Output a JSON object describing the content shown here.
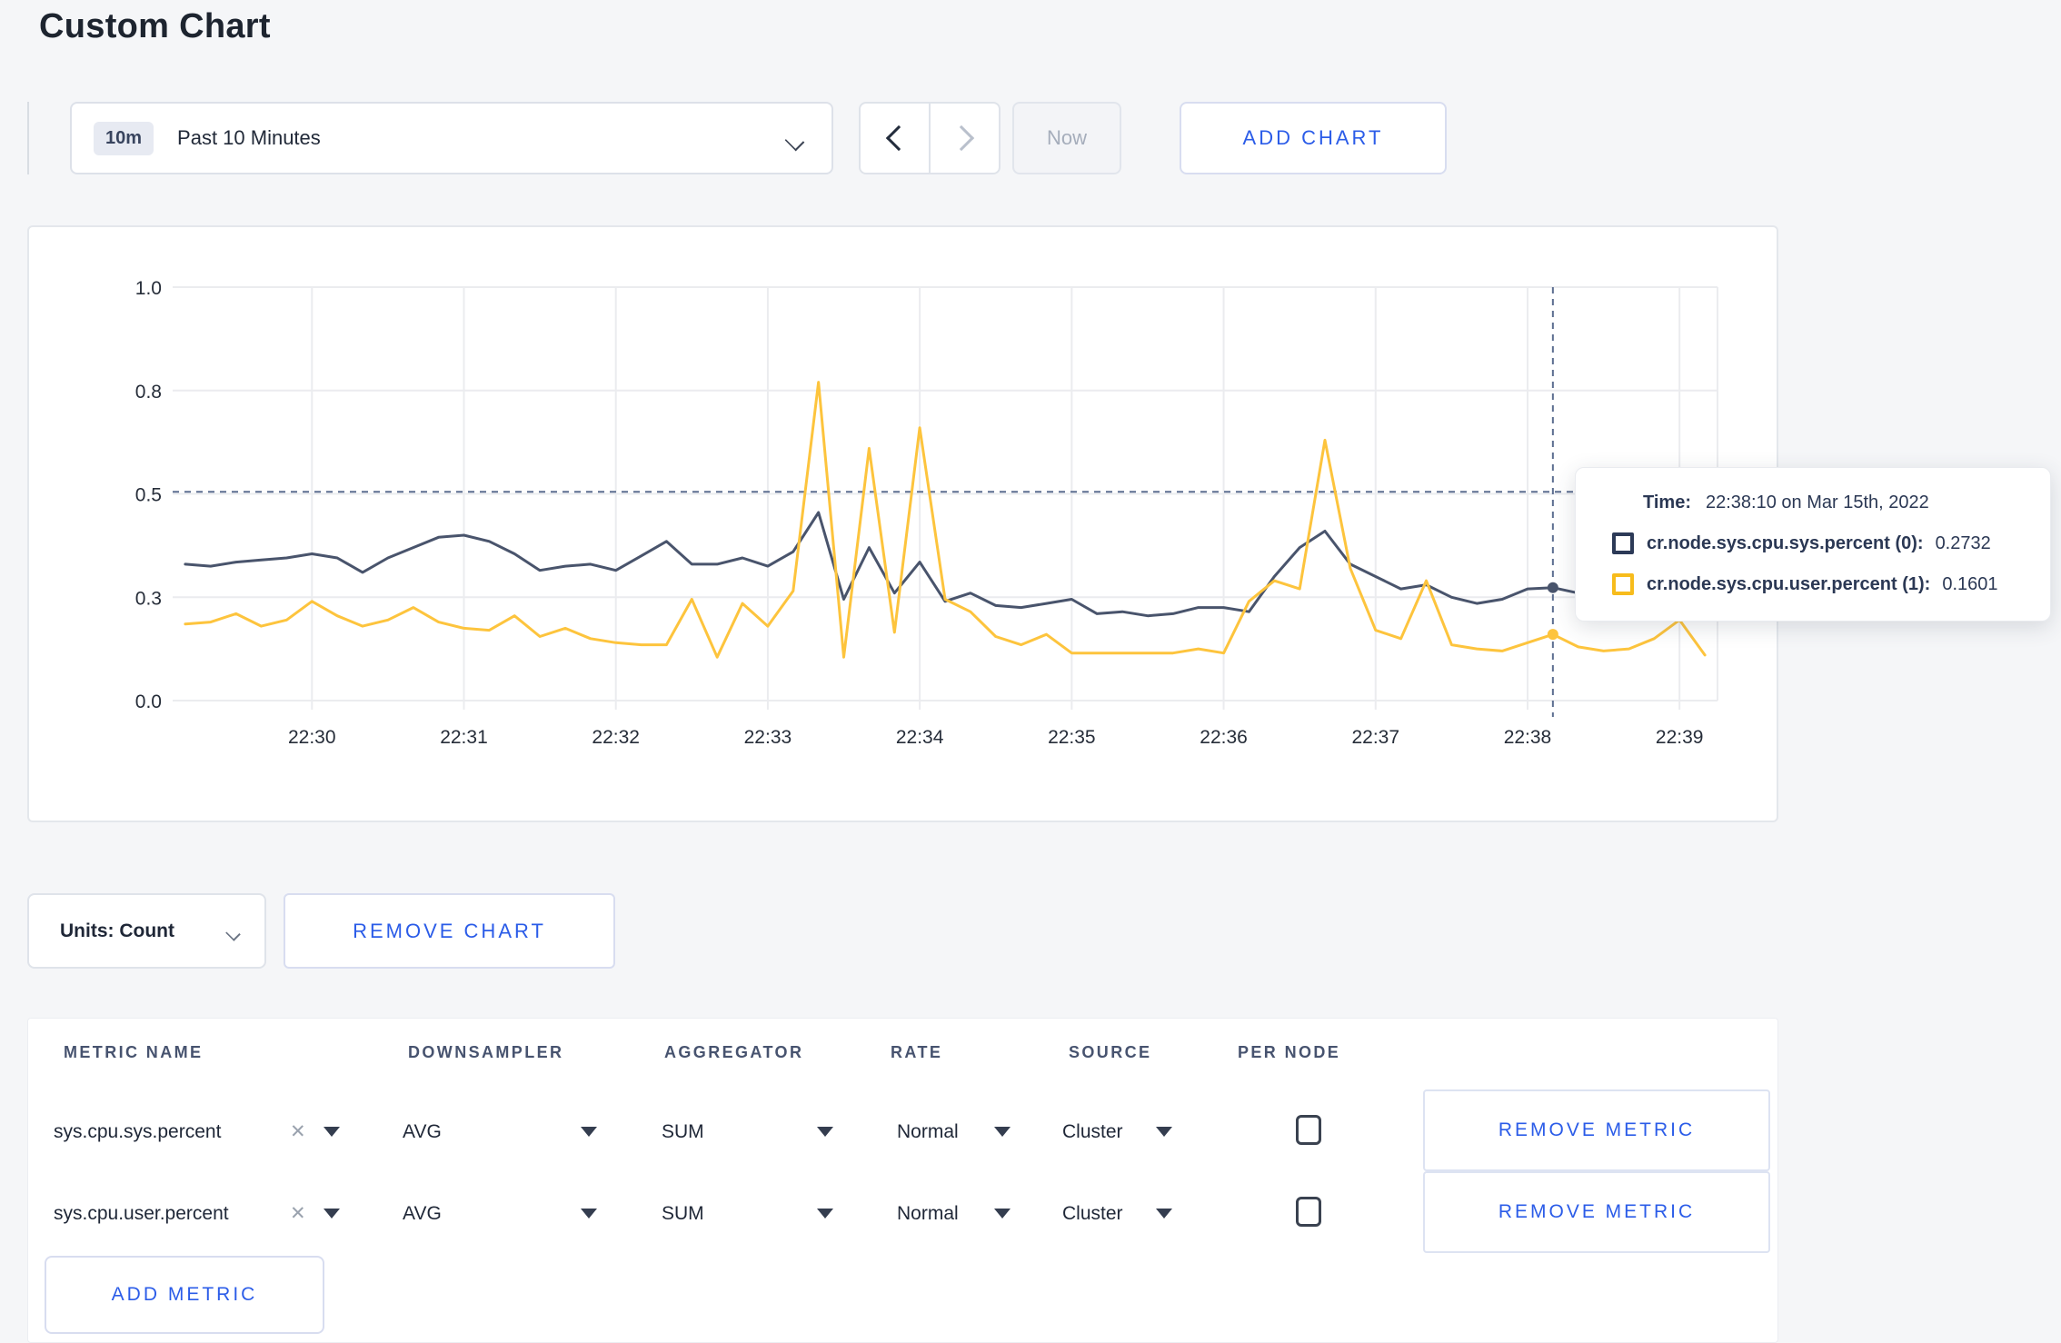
{
  "page": {
    "title": "Custom Chart"
  },
  "toolbar": {
    "range_badge": "10m",
    "range_label": "Past 10 Minutes",
    "now_label": "Now",
    "add_chart_label": "ADD CHART"
  },
  "chart_data": {
    "type": "line",
    "x_axis": {
      "domain_sec": [
        0,
        610
      ],
      "ticks": [
        {
          "sec": 55,
          "label": "22:30"
        },
        {
          "sec": 115,
          "label": "22:31"
        },
        {
          "sec": 175,
          "label": "22:32"
        },
        {
          "sec": 235,
          "label": "22:33"
        },
        {
          "sec": 295,
          "label": "22:34"
        },
        {
          "sec": 355,
          "label": "22:35"
        },
        {
          "sec": 415,
          "label": "22:36"
        },
        {
          "sec": 475,
          "label": "22:37"
        },
        {
          "sec": 535,
          "label": "22:38"
        },
        {
          "sec": 595,
          "label": "22:39"
        }
      ]
    },
    "y_axis": {
      "domain": [
        0,
        1
      ],
      "ticks": [
        {
          "v": 0,
          "label": "0.0"
        },
        {
          "v": 0.25,
          "label": "0.3"
        },
        {
          "v": 0.5,
          "label": "0.5"
        },
        {
          "v": 0.75,
          "label": "0.8"
        },
        {
          "v": 1,
          "label": "1.0"
        }
      ]
    },
    "grid": true,
    "sample_start_sec": 5,
    "sample_step_sec": 10,
    "series": [
      {
        "name": "cr.node.sys.cpu.sys.percent",
        "color": "#49546c",
        "values": [
          0.33,
          0.325,
          0.335,
          0.34,
          0.345,
          0.355,
          0.345,
          0.31,
          0.345,
          0.37,
          0.395,
          0.4,
          0.385,
          0.355,
          0.315,
          0.325,
          0.33,
          0.315,
          0.35,
          0.385,
          0.33,
          0.33,
          0.345,
          0.325,
          0.36,
          0.455,
          0.245,
          0.37,
          0.26,
          0.335,
          0.24,
          0.26,
          0.23,
          0.225,
          0.235,
          0.245,
          0.21,
          0.215,
          0.205,
          0.21,
          0.225,
          0.225,
          0.215,
          0.3,
          0.37,
          0.41,
          0.33,
          0.3,
          0.27,
          0.28,
          0.25,
          0.235,
          0.245,
          0.27,
          0.2732,
          0.26,
          0.27,
          0.26,
          0.255,
          0.265,
          0.26
        ]
      },
      {
        "name": "cr.node.sys.cpu.user.percent",
        "color": "#fdc43d",
        "values": [
          0.185,
          0.19,
          0.21,
          0.18,
          0.195,
          0.24,
          0.205,
          0.18,
          0.195,
          0.225,
          0.19,
          0.175,
          0.17,
          0.205,
          0.155,
          0.175,
          0.15,
          0.14,
          0.135,
          0.135,
          0.245,
          0.105,
          0.235,
          0.18,
          0.265,
          0.77,
          0.105,
          0.61,
          0.165,
          0.66,
          0.245,
          0.215,
          0.155,
          0.135,
          0.16,
          0.115,
          0.115,
          0.115,
          0.115,
          0.115,
          0.125,
          0.115,
          0.24,
          0.29,
          0.27,
          0.63,
          0.32,
          0.17,
          0.15,
          0.29,
          0.135,
          0.125,
          0.12,
          0.14,
          0.1601,
          0.13,
          0.12,
          0.125,
          0.15,
          0.195,
          0.11
        ]
      }
    ],
    "crosshair": {
      "x_sec": 545,
      "y_value": 0.505,
      "points": [
        {
          "series": 0,
          "value": 0.2732
        },
        {
          "series": 1,
          "value": 0.1601
        }
      ]
    }
  },
  "tooltip": {
    "time_label": "Time:",
    "time_value": "22:38:10 on Mar 15th, 2022",
    "rows": [
      {
        "label": "cr.node.sys.cpu.sys.percent (0):",
        "value": "0.2732",
        "color": "#2c3a57"
      },
      {
        "label": "cr.node.sys.cpu.user.percent (1):",
        "value": "0.1601",
        "color": "#f7bc1c"
      }
    ]
  },
  "chart_controls": {
    "units_label": "Units: Count",
    "remove_chart_label": "REMOVE CHART"
  },
  "metrics_table": {
    "headers": [
      "METRIC NAME",
      "DOWNSAMPLER",
      "AGGREGATOR",
      "RATE",
      "SOURCE",
      "PER NODE"
    ],
    "rows": [
      {
        "name": "sys.cpu.sys.percent",
        "downsampler": "AVG",
        "aggregator": "SUM",
        "rate": "Normal",
        "source": "Cluster",
        "remove_label": "REMOVE METRIC"
      },
      {
        "name": "sys.cpu.user.percent",
        "downsampler": "AVG",
        "aggregator": "SUM",
        "rate": "Normal",
        "source": "Cluster",
        "remove_label": "REMOVE METRIC"
      }
    ],
    "add_metric_label": "ADD METRIC"
  }
}
